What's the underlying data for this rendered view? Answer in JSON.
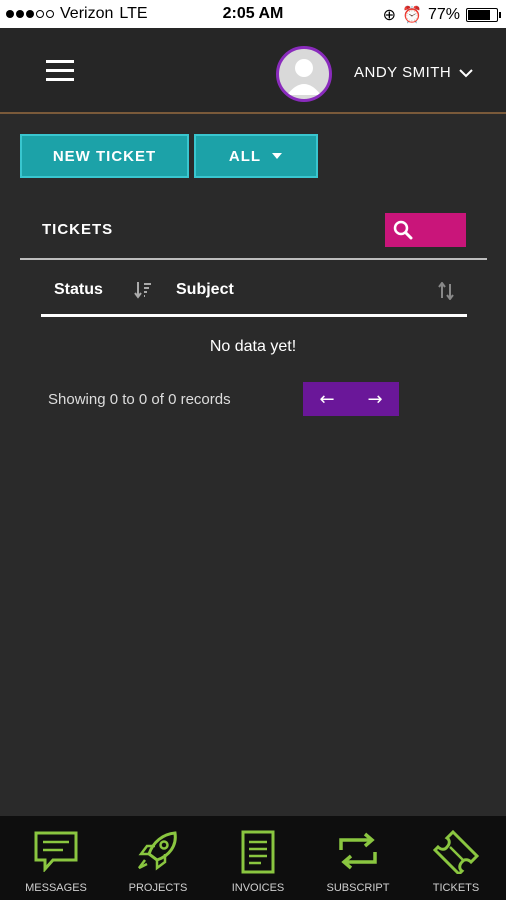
{
  "status_bar": {
    "carrier": "Verizon",
    "network": "LTE",
    "time": "2:05 AM",
    "battery": "77%"
  },
  "header": {
    "user_name": "ANDY SMITH"
  },
  "toolbar": {
    "new_ticket_label": "NEW TICKET",
    "filter_label": "ALL"
  },
  "tickets": {
    "title": "TICKETS",
    "columns": [
      "Status",
      "Subject"
    ],
    "empty_message": "No data yet!",
    "records_text": "Showing 0 to 0 of 0 records"
  },
  "bottom_nav": [
    {
      "label": "MESSAGES",
      "icon": "message-icon"
    },
    {
      "label": "PROJECTS",
      "icon": "rocket-icon"
    },
    {
      "label": "INVOICES",
      "icon": "invoice-icon"
    },
    {
      "label": "SUBSCRIPT",
      "icon": "repeat-icon"
    },
    {
      "label": "TICKETS",
      "icon": "ticket-icon"
    }
  ],
  "colors": {
    "accent_teal": "#1ca2a8",
    "accent_pink": "#c9157a",
    "accent_purple": "#6a1799",
    "nav_green": "#8ac640"
  }
}
